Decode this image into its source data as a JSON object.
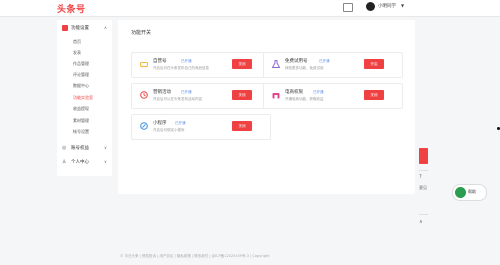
{
  "header": {
    "logo": "头条号",
    "user_name": "小明同学",
    "message_icon": "message-icon"
  },
  "sidebar": {
    "head": {
      "label": "功能设置",
      "icon": "grid-icon"
    },
    "items": [
      {
        "label": "首页",
        "active": false
      },
      {
        "label": "发表",
        "active": false
      },
      {
        "label": "作品管理",
        "active": false
      },
      {
        "label": "评论管理",
        "active": false
      },
      {
        "label": "数据中心",
        "active": false
      },
      {
        "label": "功能实验室",
        "active": true
      },
      {
        "label": "收益提现",
        "active": false
      },
      {
        "label": "素材管理",
        "active": false
      },
      {
        "label": "帐号设置",
        "active": false
      }
    ],
    "groups": [
      {
        "label": "账号权益",
        "icon": "gift-icon"
      },
      {
        "label": "个人中心",
        "icon": "user-icon"
      }
    ]
  },
  "main": {
    "section_title": "功能开关",
    "cards": [
      {
        "name": "自营号",
        "tag": "已开通",
        "desc": "开启后可在头条发布自己的商品信息",
        "button": "关闭",
        "icon": "car-icon",
        "icon_color": "#f4b93b"
      },
      {
        "name": "免费试用号",
        "tag": "已开通",
        "desc": "体验更多功能，免费试用",
        "button": "开启",
        "icon": "flask-icon",
        "icon_color": "#8e6ad8"
      },
      {
        "name": "营销活动",
        "tag": "已开通",
        "desc": "开启后可以在头条发布活动内容",
        "button": "关闭",
        "icon": "clock-icon",
        "icon_color": "#f04142"
      },
      {
        "name": "电商权限",
        "tag": "已开通",
        "desc": "开通电商功能，获取收益",
        "button": "关闭",
        "icon": "shop-icon",
        "icon_color": "#e2458f"
      },
      {
        "name": "小程序",
        "tag": "已开通",
        "desc": "开启后可绑定小程序",
        "button": "关闭",
        "icon": "link-icon",
        "icon_color": "#3a8ee6"
      }
    ]
  },
  "footer": {
    "text": "© 今日头条 | 侵权投诉 | 用户协议 | 隐私政策 | 联系我们 | 京ICP备12025439号-3 | Copyright"
  },
  "right_panel": {
    "items": [
      {
        "label": "?",
        "icon": "help-icon"
      },
      {
        "label": "意见",
        "icon": "feedback-icon"
      },
      {
        "label": "∧",
        "icon": "back-to-top-icon"
      }
    ]
  },
  "float_bubble": {
    "label": "帮助"
  },
  "colors": {
    "accent": "#f04142",
    "tag": "#5b8ee6"
  }
}
